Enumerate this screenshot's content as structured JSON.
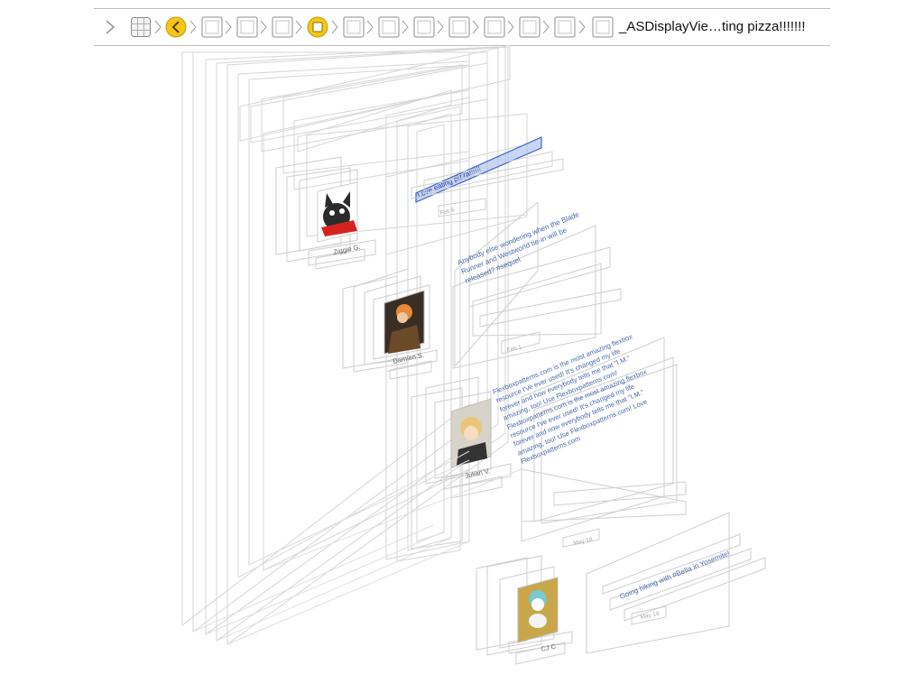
{
  "jump_bar": {
    "items": [
      {
        "icon": "chevron-right-icon"
      },
      {
        "icon": "window-grid-icon"
      },
      {
        "icon": "back-circle-icon",
        "color": "#f5c518"
      },
      {
        "icon": "view-square-icon"
      },
      {
        "icon": "view-square-icon"
      },
      {
        "icon": "view-square-icon"
      },
      {
        "icon": "stop-circle-icon",
        "color": "#f5c518"
      },
      {
        "icon": "view-square-icon"
      },
      {
        "icon": "view-square-icon"
      },
      {
        "icon": "view-square-icon"
      },
      {
        "icon": "view-square-icon"
      },
      {
        "icon": "view-square-icon"
      },
      {
        "icon": "view-square-icon"
      },
      {
        "icon": "view-square-icon"
      },
      {
        "icon": "view-square-icon"
      }
    ],
    "selected_title": "_ASDisplayVie…ting pizza!!!!!!!"
  },
  "view_hierarchy": {
    "selected_view_color": "#9db3ef",
    "posts": [
      {
        "user": "Ziggie G.",
        "text": "Love eating pizza!!!!!!",
        "timestamp": "Feb 6"
      },
      {
        "user": "Damien S.",
        "text": "Anybody else wondering when the Blade Runner and Westworld tie-in will be released? #sequel",
        "timestamp": "Feb 1"
      },
      {
        "user": "Julian V.",
        "text": "Flexboxpatterns.com is the most amazing flexbox resource I've ever used! It's changed my life forever and now everybody tells me that \"I.M.\" amazing, too! Use Flexboxpatterns.com! Flexboxpatterns.com is the most amazing flexbox resource I've ever used! It's changed my life forever and now everybody tells me that \"I.M.\" amazing, too! Use Flexboxpatterns.com! Love Flexboxpatterns.com",
        "timestamp": "May 18"
      },
      {
        "user": "CJ C.",
        "text": "Going hiking with #Bella in Yosemite!",
        "timestamp": "May 19"
      }
    ]
  }
}
